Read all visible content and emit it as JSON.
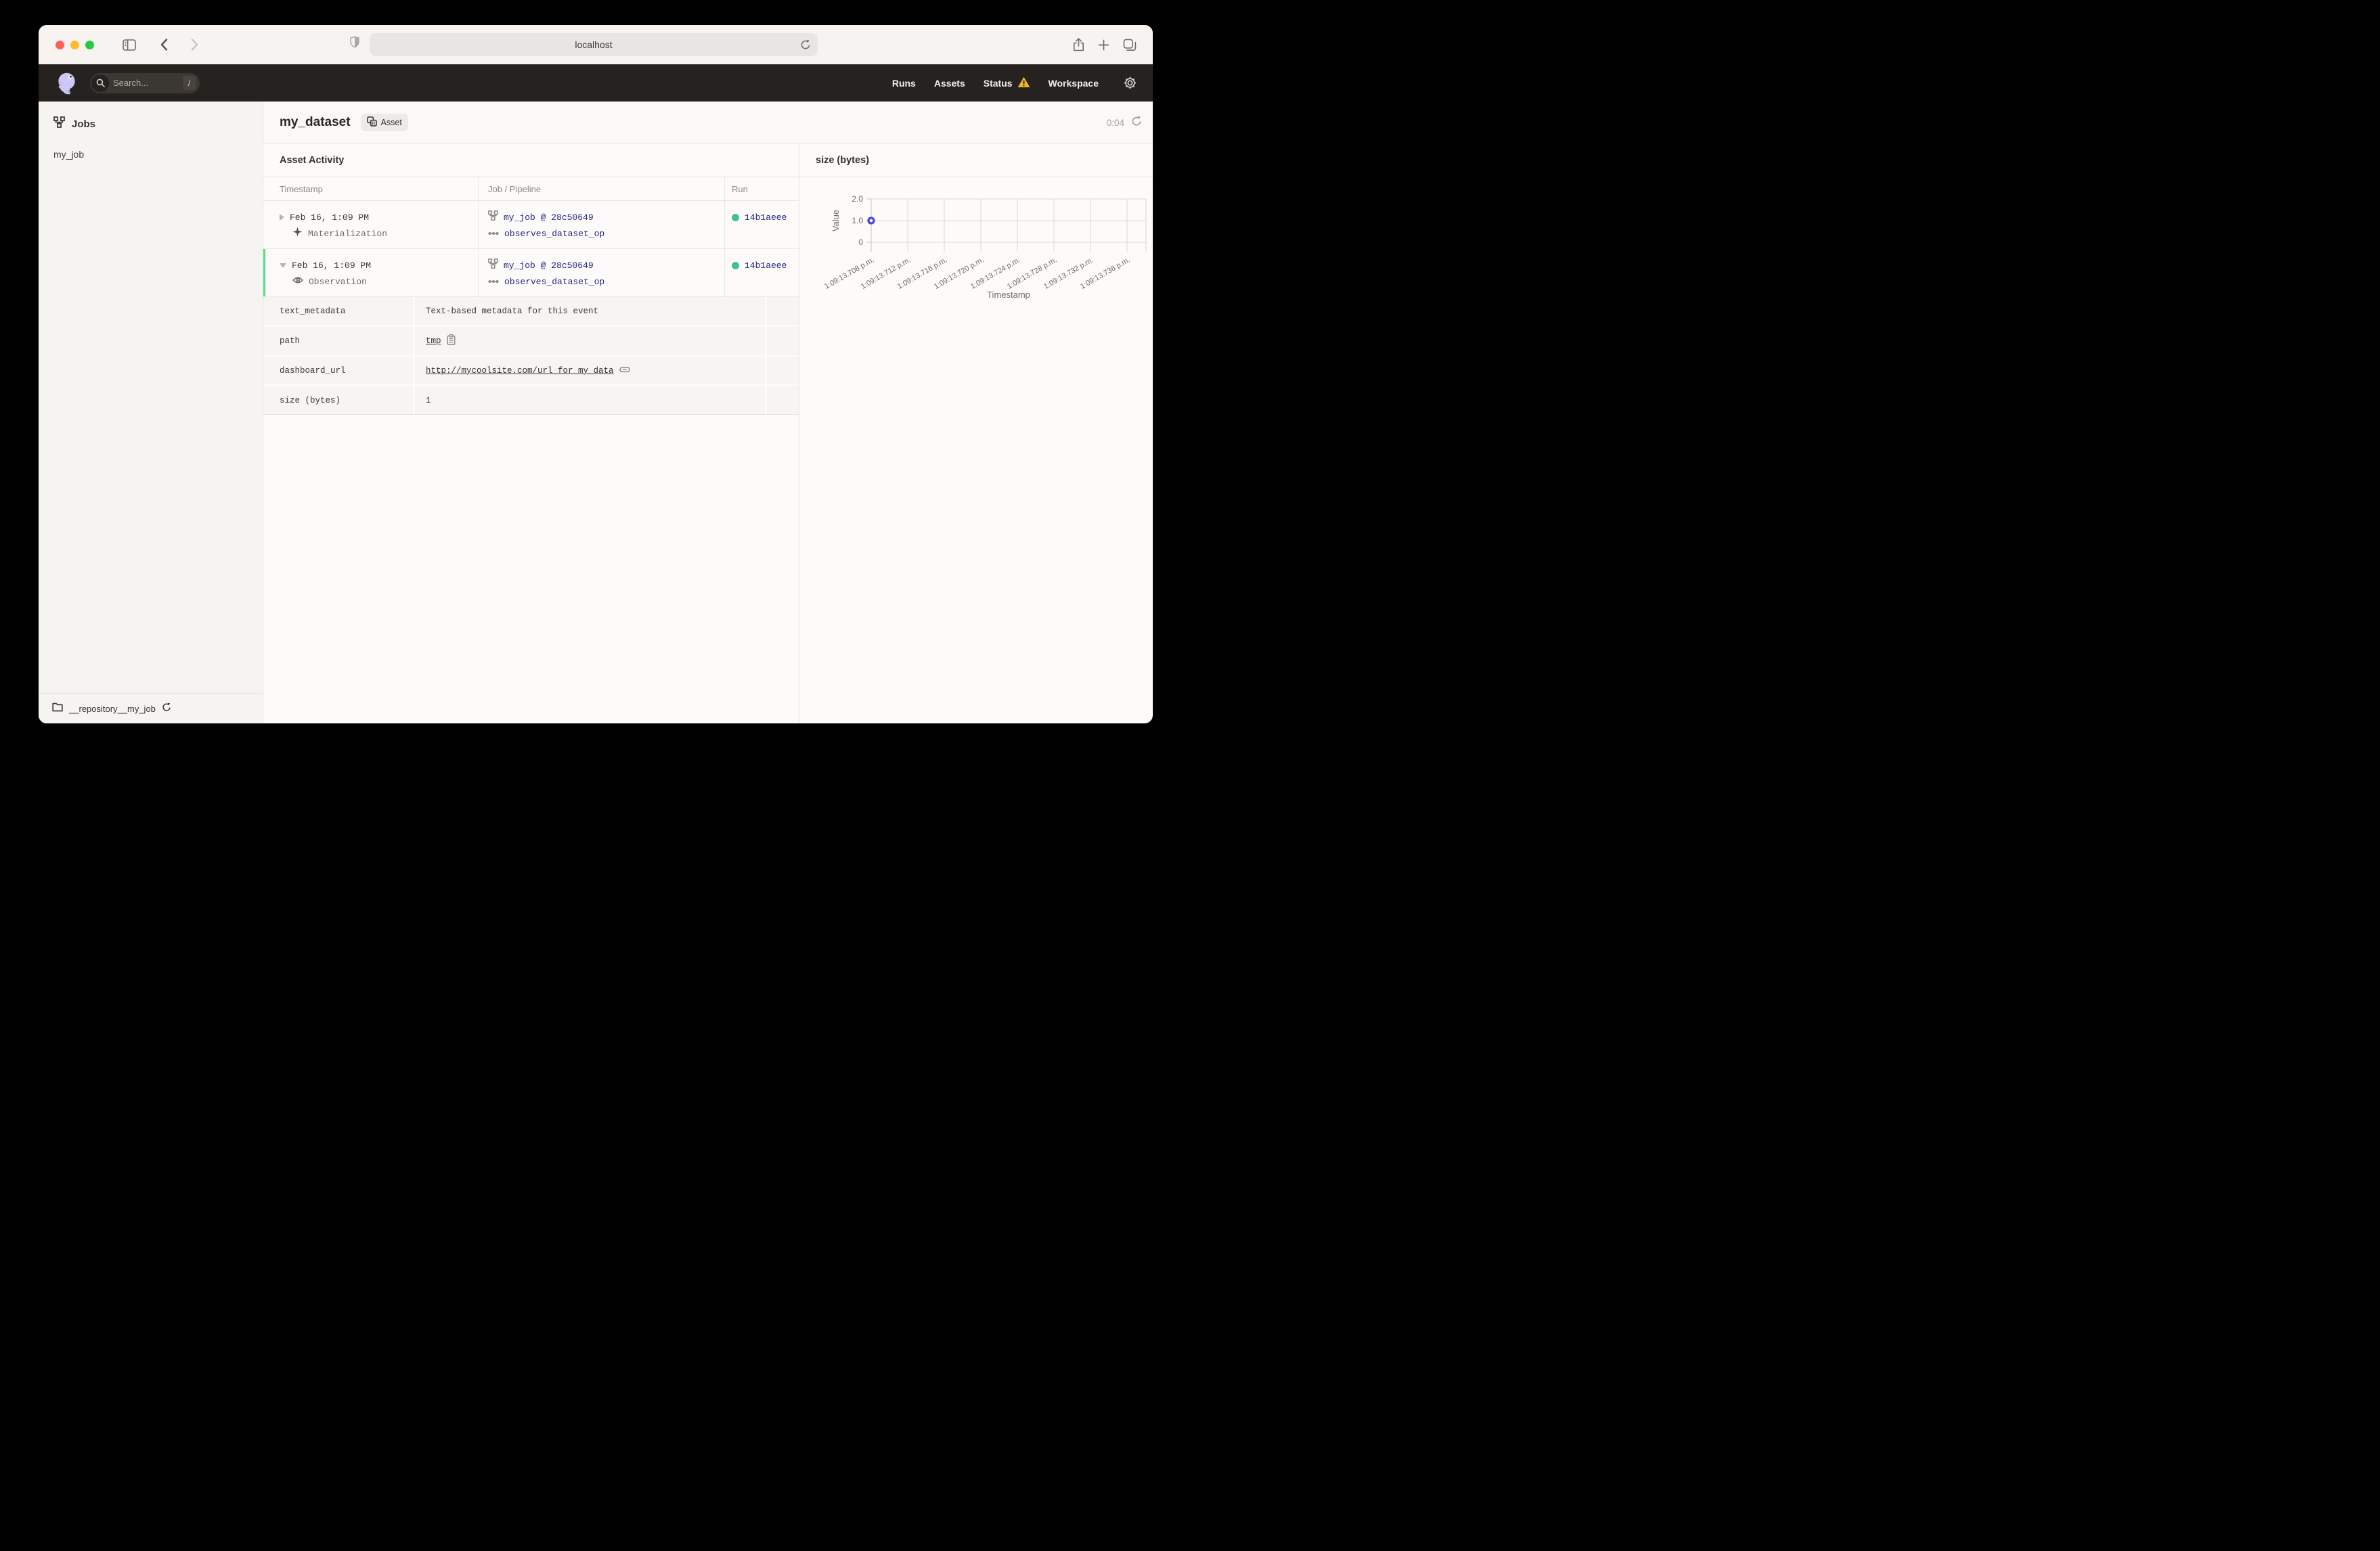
{
  "browser": {
    "url": "localhost"
  },
  "topnav": {
    "search_placeholder": "Search...",
    "search_shortcut": "/",
    "links": [
      {
        "label": "Runs",
        "warning": false
      },
      {
        "label": "Assets",
        "warning": false
      },
      {
        "label": "Status",
        "warning": true
      },
      {
        "label": "Workspace",
        "warning": false
      }
    ]
  },
  "sidebar": {
    "section_title": "Jobs",
    "items": [
      {
        "label": "my_job"
      }
    ],
    "footer": {
      "repository": "__repository__my_job"
    }
  },
  "header": {
    "title": "my_dataset",
    "tag": "Asset",
    "timer": "0:04"
  },
  "activity": {
    "title": "Asset Activity",
    "columns": [
      "Timestamp",
      "Job / Pipeline",
      "Run"
    ],
    "rows": [
      {
        "timestamp": "Feb 16, 1:09 PM",
        "event_type": "Materialization",
        "job": "my_job @ 28c50649",
        "op": "observes_dataset_op",
        "run_id": "14b1aeee",
        "expanded": false
      },
      {
        "timestamp": "Feb 16, 1:09 PM",
        "event_type": "Observation",
        "job": "my_job @ 28c50649",
        "op": "observes_dataset_op",
        "run_id": "14b1aeee",
        "expanded": true
      }
    ],
    "metadata": [
      {
        "key": "text_metadata",
        "value": "Text-based metadata for this event",
        "type": "text"
      },
      {
        "key": "path",
        "value": "tmp",
        "type": "path"
      },
      {
        "key": "dashboard_url",
        "value": "http://mycoolsite.com/url_for_my_data",
        "type": "url"
      },
      {
        "key": "size (bytes)",
        "value": "1",
        "type": "text"
      }
    ]
  },
  "chart_data": {
    "type": "scatter",
    "title": "size (bytes)",
    "xlabel": "Timestamp",
    "ylabel": "Value",
    "x_tick_labels": [
      "1:09:13.708 p.m.",
      "1:09:13.712 p.m.",
      "1:09:13.716 p.m.",
      "1:09:13.720 p.m.",
      "1:09:13.724 p.m.",
      "1:09:13.728 p.m.",
      "1:09:13.732 p.m.",
      "1:09:13.736 p.m."
    ],
    "y_ticks": [
      {
        "value": 0,
        "label": "0"
      },
      {
        "value": 1,
        "label": "1.0"
      },
      {
        "value": 2,
        "label": "2.0"
      }
    ],
    "ylim": [
      0,
      2
    ],
    "grid": true,
    "legend": "none",
    "points": [
      {
        "x_label": "1:09:13.708 p.m.",
        "y": 1
      }
    ],
    "point_color": "#4a42da"
  },
  "colors": {
    "nav_bg": "#262220",
    "accent_green": "#3fc28d",
    "expanded_border_green": "#4ee08b",
    "link_navy": "#232384",
    "warning_amber": "#f0b32a",
    "point_indigo": "#4a42da"
  }
}
